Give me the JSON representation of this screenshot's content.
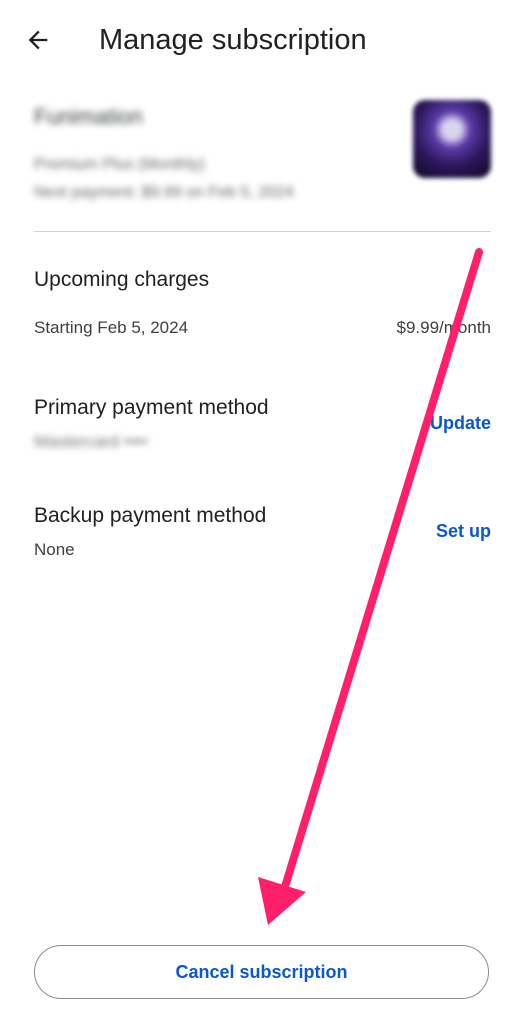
{
  "header": {
    "title": "Manage subscription",
    "back_icon": "arrow-left-icon"
  },
  "subscription": {
    "app_name": "Funimation",
    "plan": "Premium Plus (Monthly)",
    "next_payment": "Next payment: $9.99 on Feb 5, 2024",
    "thumbnail_icon": "app-thumbnail"
  },
  "upcoming_charges": {
    "title": "Upcoming charges",
    "start": "Starting Feb 5, 2024",
    "price": "$9.99/month"
  },
  "primary_payment": {
    "title": "Primary payment method",
    "value": "Mastercard ••••",
    "action": "Update"
  },
  "backup_payment": {
    "title": "Backup payment method",
    "value": "None",
    "action": "Set up"
  },
  "cancel": {
    "label": "Cancel subscription"
  },
  "colors": {
    "accent": "#0b57d0",
    "annotation_arrow": "#ff1f6a"
  }
}
